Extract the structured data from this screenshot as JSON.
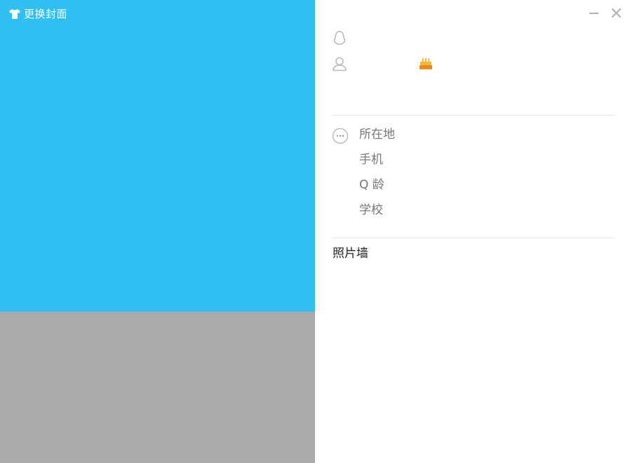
{
  "left": {
    "change_cover_label": "更换封面",
    "icon": "shirt-icon",
    "cover_color": "#2fc0f1",
    "lower_color": "#a9aaac"
  },
  "window_controls": {
    "minimize_icon": "minimize-icon",
    "close_icon": "close-icon"
  },
  "profile": {
    "qq_icon": "qq-penguin-icon",
    "user_icon": "user-icon",
    "birthday_icon": "birthday-cake-icon"
  },
  "info": {
    "more_icon": "more-icon",
    "location_label": "所在地",
    "phone_label": "手机",
    "qage_label": "Q 龄",
    "school_label": "学校"
  },
  "photo_wall": {
    "label": "照片墙"
  }
}
